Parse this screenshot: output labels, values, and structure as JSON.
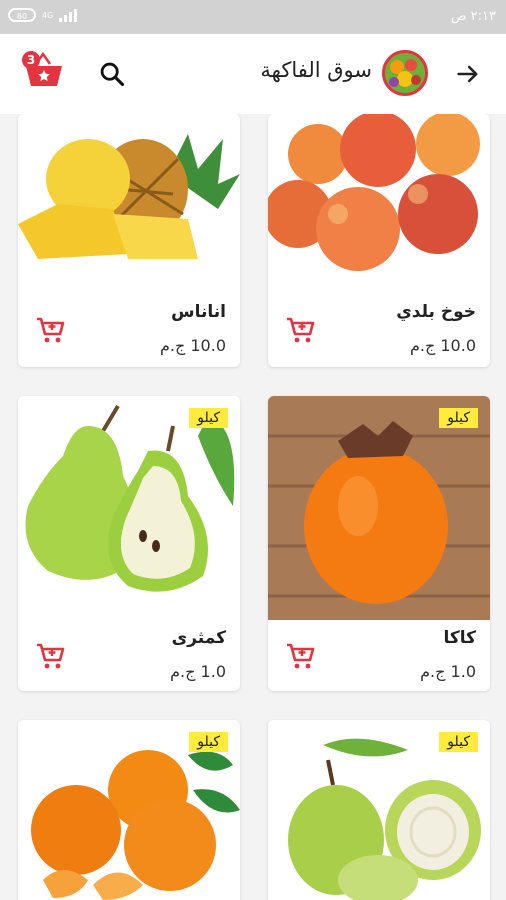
{
  "status": {
    "battery": "80",
    "network": "4G",
    "time": "٢:١٣ ص"
  },
  "header": {
    "title": "سوق الفاكهة",
    "cart_count": "3"
  },
  "colors": {
    "accent": "#e3343f",
    "badge": "#ffeb3b"
  },
  "products": [
    {
      "name": "خوخ بلدي",
      "price": "10.0 ج.م",
      "unit": ""
    },
    {
      "name": "اناناس",
      "price": "10.0 ج.م",
      "unit": ""
    },
    {
      "name": "كاكا",
      "price": "1.0 ج.م",
      "unit": "كيلو"
    },
    {
      "name": "كمثرى",
      "price": "1.0 ج.م",
      "unit": "كيلو"
    },
    {
      "name": "",
      "price": "",
      "unit": "كيلو"
    },
    {
      "name": "",
      "price": "",
      "unit": "كيلو"
    }
  ]
}
